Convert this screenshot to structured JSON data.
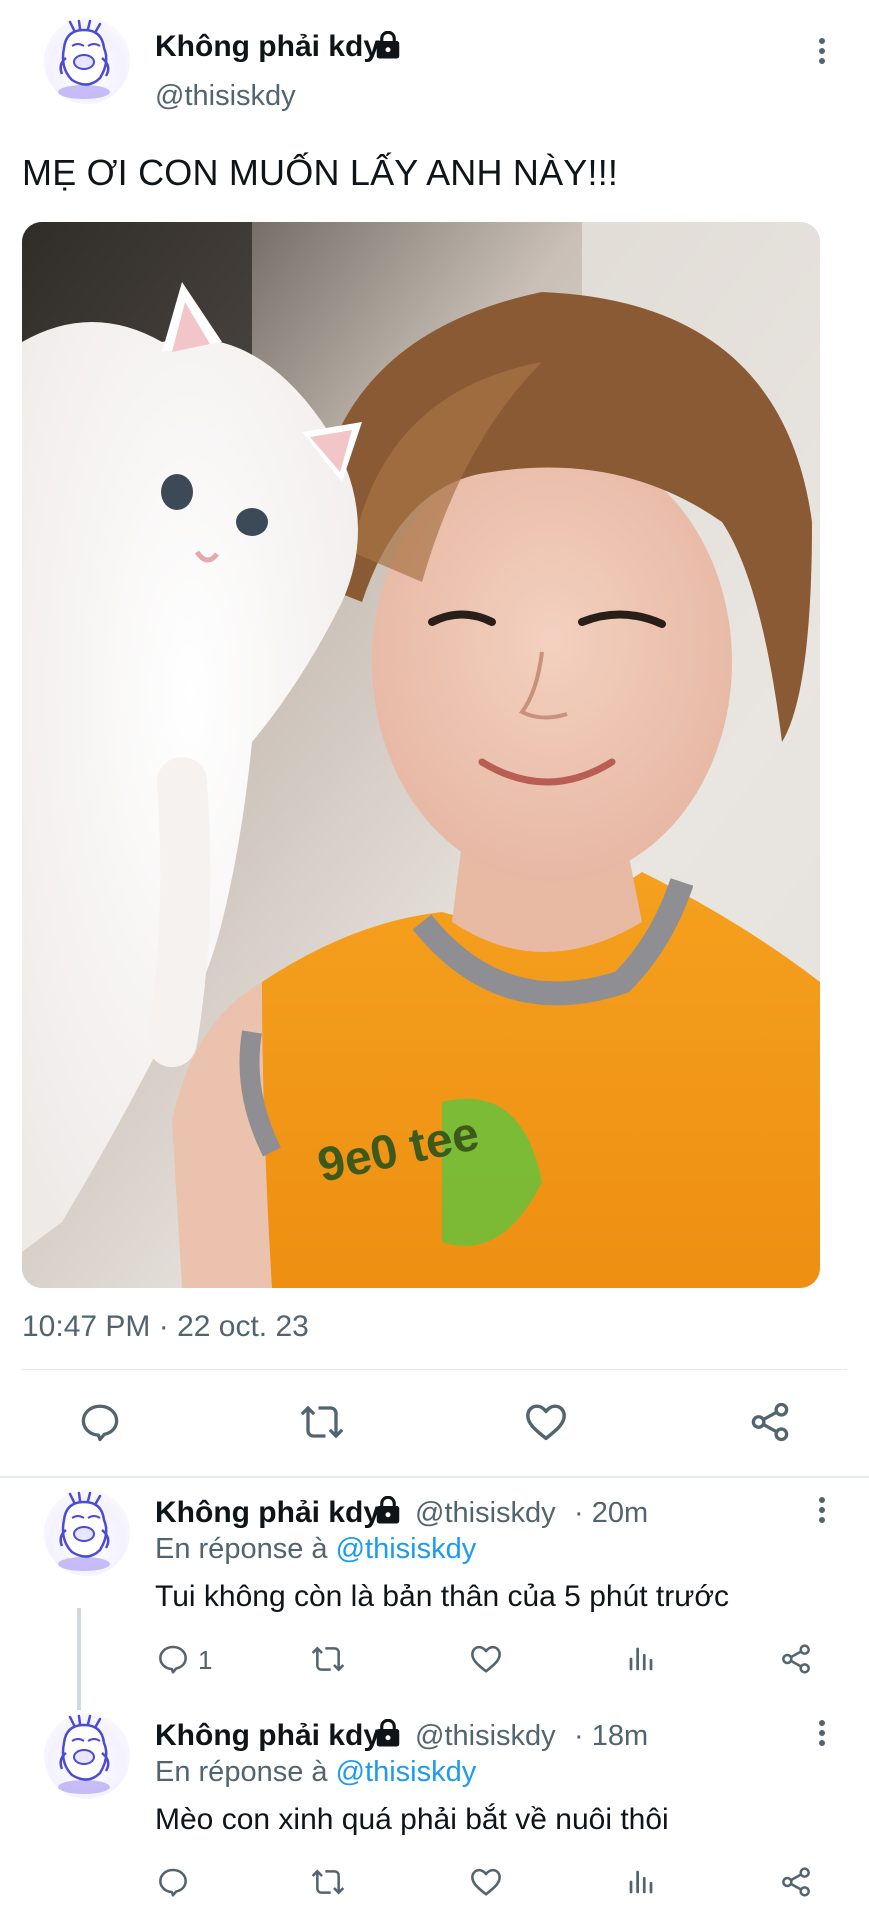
{
  "main_tweet": {
    "author_name": "Không phải kdy",
    "handle": "@thisiskdy",
    "text": "MẸ ƠI CON MUỐN LẤY ANH NÀY!!!",
    "timestamp": "10:47 PM · 22 oct. 23",
    "actions": [
      "reply-icon",
      "retweet-icon",
      "like-icon",
      "share-icon"
    ]
  },
  "replies": [
    {
      "author_name": "Không phải kdy",
      "handle": "@thisiskdy",
      "time": "· 20m",
      "reply_prefix": "En réponse à",
      "reply_mention": "@thisiskdy",
      "text": "Tui không còn là bản thân của 5 phút trước",
      "reply_count": "1"
    },
    {
      "author_name": "Không phải kdy",
      "handle": "@thisiskdy",
      "time": "· 18m",
      "reply_prefix": "En réponse à",
      "reply_mention": "@thisiskdy",
      "text": "Mèo con xinh quá phải bắt về nuôi thôi",
      "reply_count": ""
    }
  ],
  "colors": {
    "text_primary": "#0f1419",
    "text_secondary": "#536471",
    "link": "#1d9bf0",
    "shirt_orange": "#f29a1c"
  }
}
